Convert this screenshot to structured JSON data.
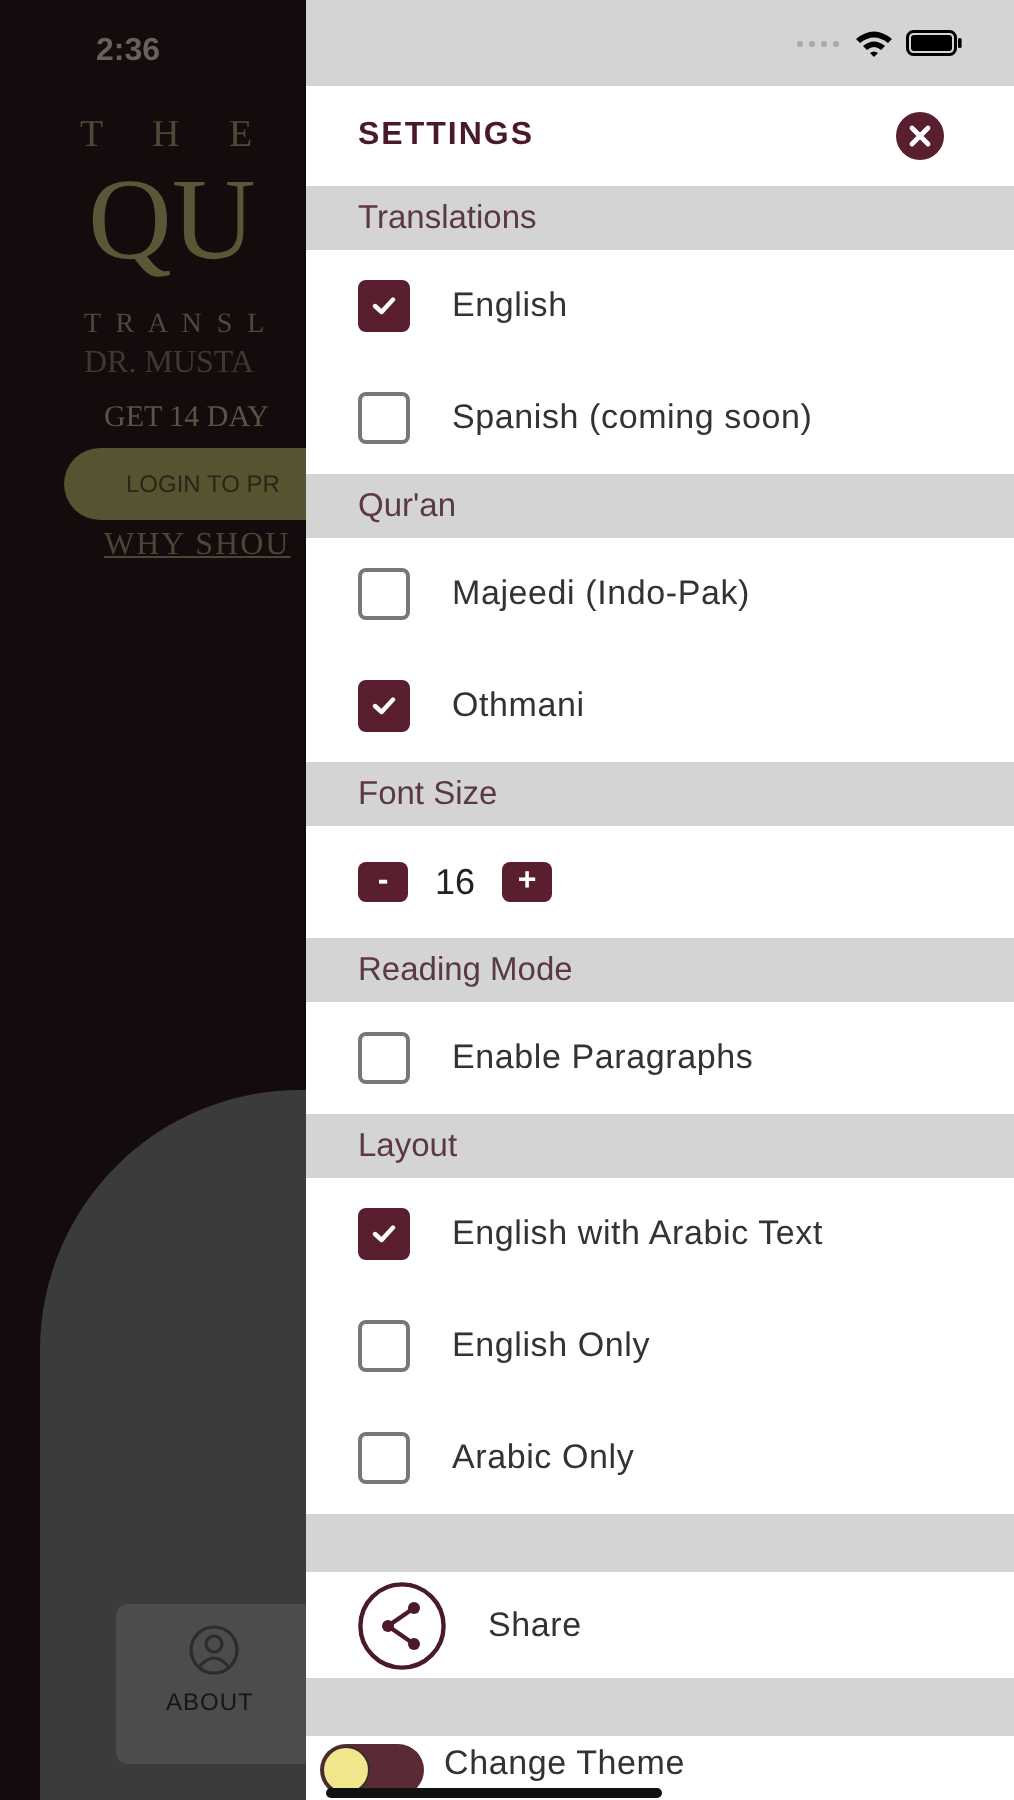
{
  "status_bar": {
    "time": "2:36"
  },
  "background_app": {
    "heading_small": "T H E",
    "heading_large": "QU",
    "subtitle_line_1": "T R A N S L",
    "subtitle_line_2": "DR. MUSTA",
    "offer": "GET 14 DAY",
    "login_button": "LOGIN TO PR",
    "link": "WHY SHOU",
    "about_tab": "ABOUT"
  },
  "settings": {
    "title": "SETTINGS",
    "sections": [
      {
        "title": "Translations",
        "items": [
          {
            "kind": "checkbox",
            "label": "English",
            "checked": true
          },
          {
            "kind": "checkbox",
            "label": "Spanish (coming soon)",
            "checked": false
          }
        ]
      },
      {
        "title": "Qur'an",
        "items": [
          {
            "kind": "checkbox",
            "label": "Majeedi (Indo-Pak)",
            "checked": false
          },
          {
            "kind": "checkbox",
            "label": "Othmani",
            "checked": true
          }
        ]
      },
      {
        "title": "Font Size",
        "items": [
          {
            "kind": "stepper",
            "decrease": "-",
            "value": "16",
            "increase": "+"
          }
        ]
      },
      {
        "title": "Reading Mode",
        "items": [
          {
            "kind": "checkbox",
            "label": "Enable Paragraphs",
            "checked": false
          }
        ]
      },
      {
        "title": "Layout",
        "items": [
          {
            "kind": "checkbox",
            "label": "English with Arabic Text",
            "checked": true
          },
          {
            "kind": "checkbox",
            "label": "English Only",
            "checked": false
          },
          {
            "kind": "checkbox",
            "label": "Arabic Only",
            "checked": false
          }
        ]
      },
      {
        "items": [
          {
            "kind": "action",
            "label": "Share"
          }
        ]
      },
      {
        "items": [
          {
            "kind": "toggle",
            "label": "Change Theme",
            "on": false
          }
        ]
      }
    ]
  }
}
